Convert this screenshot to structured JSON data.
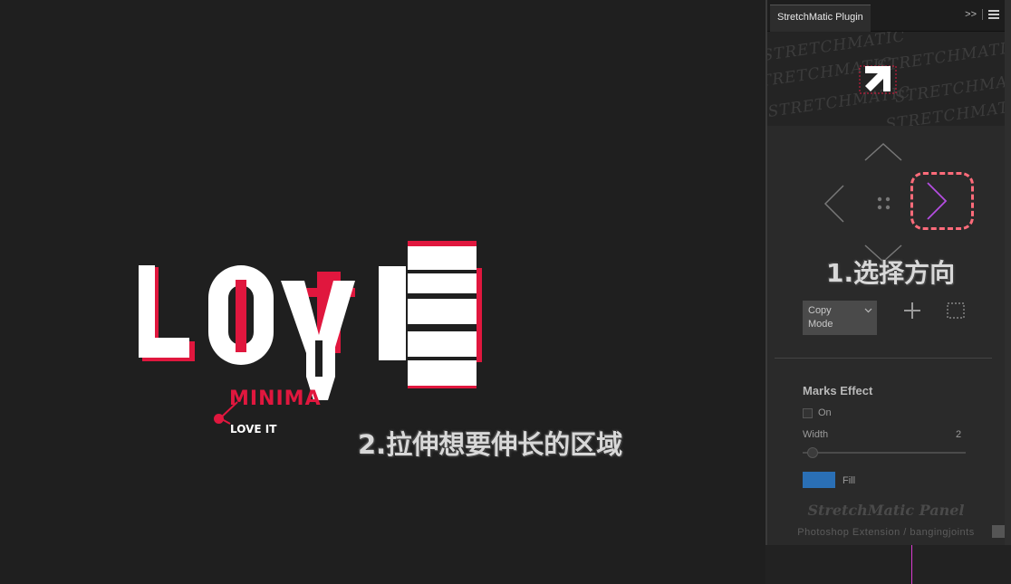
{
  "canvas": {
    "artwork_texts": {
      "love_letters": [
        "L",
        "O",
        "V",
        "E"
      ],
      "minimal": "MINIMA",
      "love_it": "LOVE IT"
    },
    "annotation_stretch": "2.拉伸想要伸长的区域",
    "annotation_direction": "1.选择方向"
  },
  "panel": {
    "tab_title": "StretchMatic Plugin",
    "menu_collapse_icon": ">>",
    "menu_icon": "hamburger-icon",
    "banner_scribble": "STRETCHMATIC",
    "copy_mode": {
      "line1": "Copy",
      "line2": "Mode"
    },
    "marks_effect": {
      "heading": "Marks Effect",
      "on_label": "On",
      "on_checked": false,
      "width_label": "Width",
      "width_value": "2",
      "width_level": 0.03,
      "fill_label": "Fill"
    },
    "footer_title": "StretchMatic Panel",
    "footer_subtitle": "Photoshop Extension / bangingjoints"
  },
  "colors": {
    "accent_red": "#e0173e",
    "fill_swatch": "#2a6fb5",
    "highlight_dash": "#ff6b7a",
    "arrow_purple": "#b44de0"
  }
}
